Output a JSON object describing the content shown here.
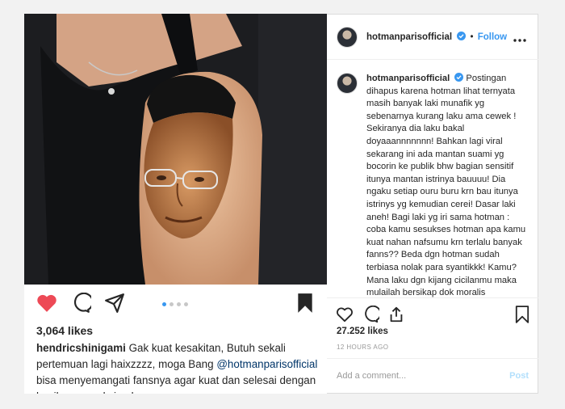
{
  "left_post": {
    "likes": "3,064 likes",
    "caption_user": "hendricshinigami",
    "caption_part1": "Gak kuat kesakitan, Butuh sekali pertemuan lagi haixzzzz, moga Bang",
    "caption_mention": "@hotmanparisofficial",
    "caption_part2": "bisa menyemangati fansnya agar kuat dan selesai dengan hasil yang maksimal",
    "carousel": {
      "count": 4,
      "active": 0
    }
  },
  "right_post": {
    "username": "hotmanparisofficial",
    "separator": "•",
    "follow_label": "Follow",
    "comment_user": "hotmanparisofficial",
    "comment_text": "Postingan dihapus karena hotman lihat ternyata masih banyak laki munafik yg sebenarnya kurang laku ama cewek ! Sekiranya dia laku bakal doyaaannnnnnn! Bahkan lagi viral sekarang ini ada mantan suami yg bocorin ke publik bhw bagian sensitif itunya mantan istrinya bauuuu! Dia ngaku setiap ouru buru krn bau itunya istrinys yg kemudian cerei! Dasar laki aneh! Bagi laki yg iri sama hotman : coba kamu sesukses hotman apa kamu kuat nahan nafsumu krn terlalu banyak fanns?? Beda dgn hotman sudah terbiasa nolak para syantikkk! Kamu? Mana laku dgn kijang cicilanmu maka mulailah bersikap dok moralis",
    "likes": "27.252 likes",
    "time": "12 HOURS AGO",
    "add_comment_placeholder": "Add a comment...",
    "post_label": "Post"
  },
  "icons": {
    "like_left": "heart-filled-icon",
    "comment_left": "comment-bubble-icon",
    "share_left": "paper-plane-icon",
    "save_left": "bookmark-filled-icon",
    "like_right": "heart-outline-icon",
    "comment_right": "comment-bubble-icon",
    "share_right": "share-upload-icon",
    "save_right": "bookmark-outline-icon",
    "more": "more-horizontal-icon",
    "verified": "verified-badge-icon"
  },
  "colors": {
    "like_red": "#ed4956",
    "link_blue": "#3897f0",
    "mention_blue": "#003569",
    "muted_gray": "#999999",
    "post_disabled": "#b2dffc"
  }
}
